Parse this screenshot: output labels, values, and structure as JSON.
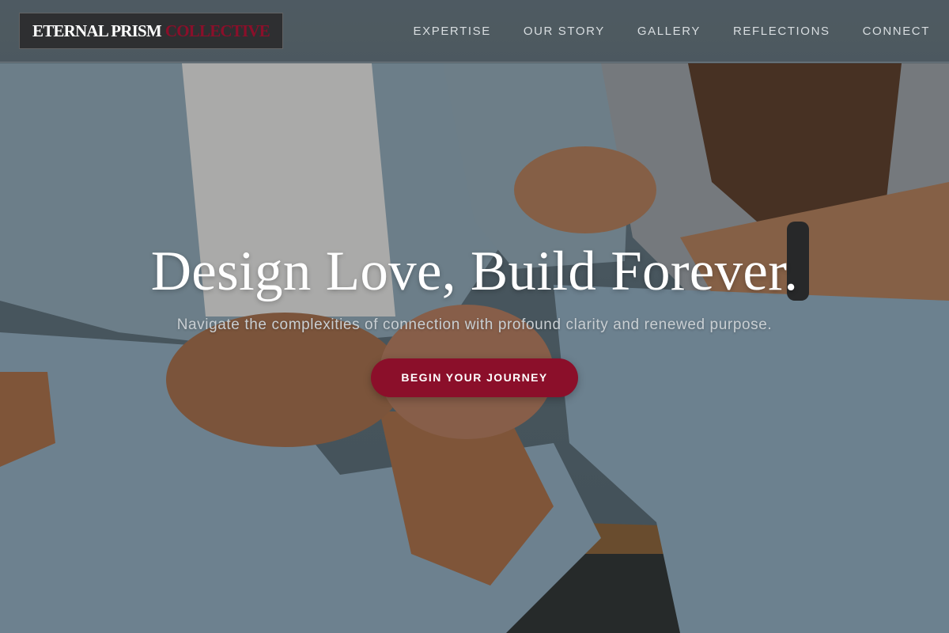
{
  "brand": {
    "name_main": "ETERNAL PRISM",
    "name_accent": "COLLECTIVE",
    "accent_color": "#8b0f2a"
  },
  "nav": {
    "items": [
      {
        "label": "EXPERTISE"
      },
      {
        "label": "OUR STORY"
      },
      {
        "label": "GALLERY"
      },
      {
        "label": "REFLECTIONS"
      },
      {
        "label": "CONNECT"
      }
    ]
  },
  "hero": {
    "title": "Design Love, Build Forever.",
    "subtitle": "Navigate the complexities of connection with profound clarity and renewed purpose.",
    "cta_label": "BEGIN YOUR JOURNEY",
    "background_image": "photo of two people in denim holding hands on a wooden bench"
  }
}
